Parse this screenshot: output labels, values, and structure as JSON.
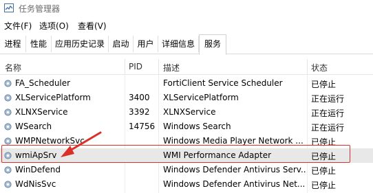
{
  "window": {
    "title": "任务管理器"
  },
  "menu": [
    "文件(F)",
    "选项(O)",
    "查看(V)"
  ],
  "tabs": [
    "进程",
    "性能",
    "应用历史记录",
    "启动",
    "用户",
    "详细信息",
    "服务"
  ],
  "active_tab": "服务",
  "columns": {
    "name": "名称",
    "pid": "PID",
    "desc": "描述",
    "status": "状态"
  },
  "services": [
    {
      "name": "FA_Scheduler",
      "pid": "",
      "desc": "FortiClient Service Scheduler",
      "status": "已停止"
    },
    {
      "name": "XLServicePlatform",
      "pid": "3400",
      "desc": "XLServicePlatform",
      "status": "正在运行"
    },
    {
      "name": "XLNXService",
      "pid": "3392",
      "desc": "XLNXService",
      "status": "正在运行"
    },
    {
      "name": "WSearch",
      "pid": "14756",
      "desc": "Windows Search",
      "status": "正在运行"
    },
    {
      "name": "WMPNetworkSvc",
      "pid": "",
      "desc": "Windows Media Player Network ...",
      "status": "已停止"
    },
    {
      "name": "wmiApSrv",
      "pid": "",
      "desc": "WMI Performance Adapter",
      "status": "已停止"
    },
    {
      "name": "WinDefend",
      "pid": "",
      "desc": "Windows Defender Antivirus Serv...",
      "status": "已停止"
    },
    {
      "name": "WdNisSvc",
      "pid": "",
      "desc": "Windows Defender Antivirus Net...",
      "status": "已停止"
    }
  ],
  "selected_service": "wmiApSrv",
  "annotation_color": "#d9302a",
  "icons": {
    "app": "task-manager-icon",
    "service": "gear-icon"
  }
}
